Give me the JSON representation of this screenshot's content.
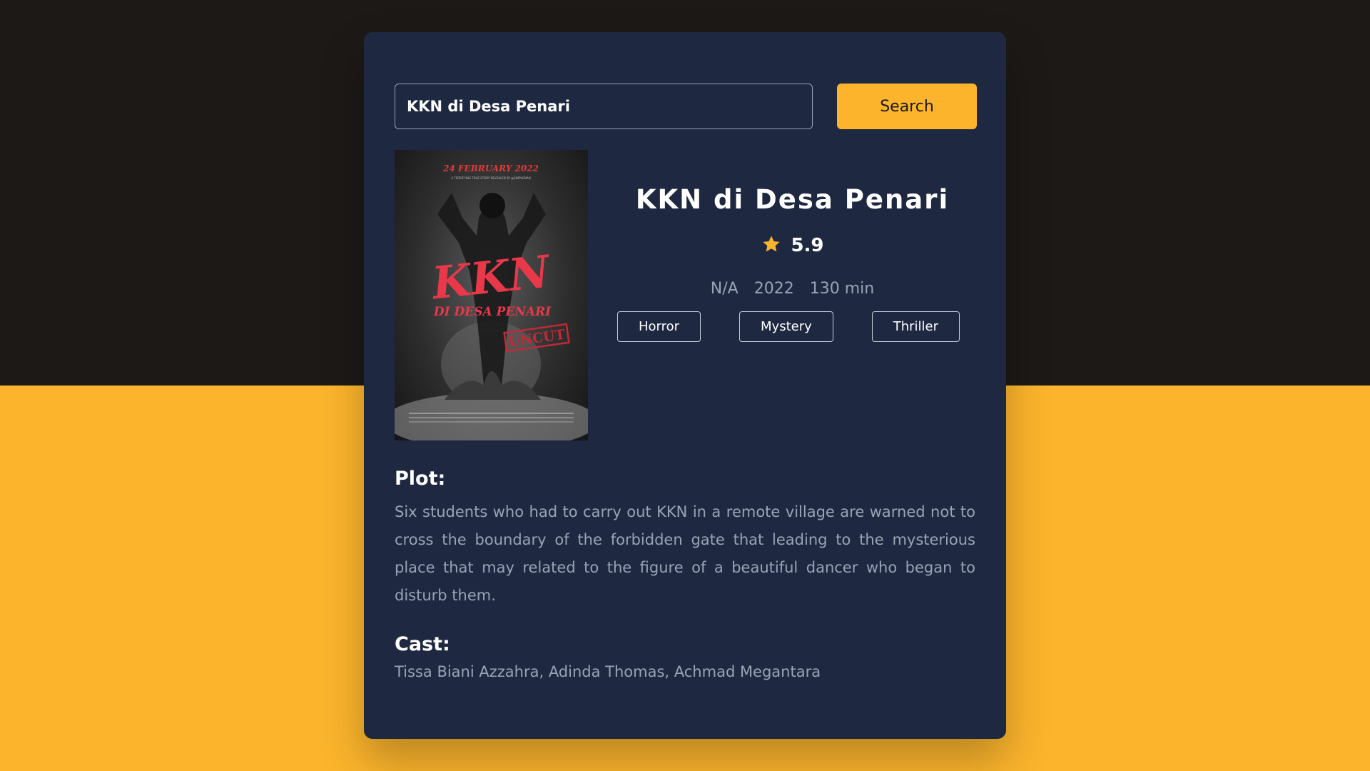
{
  "search": {
    "value": "KKN di Desa Penari",
    "button_label": "Search"
  },
  "poster": {
    "date_text": "24 FEBRUARY 2022",
    "tagline": "A TERRIFYING TRUE STORY REVEALED BY @SIMPLEMAN",
    "logo_top": "KKN",
    "logo_bottom": "DI DESA PENARI",
    "stamp": "UNCUT"
  },
  "movie": {
    "title": "KKN di Desa Penari",
    "rating": "5.9",
    "rated": "N/A",
    "year": "2022",
    "runtime": "130 min",
    "genres": [
      "Horror",
      "Mystery",
      "Thriller"
    ],
    "plot_label": "Plot:",
    "plot": "Six students who had to carry out KKN in a remote village are warned not to cross the boundary of the forbidden gate that leading to the mysterious place that may related to the figure of a beautiful dancer who began to disturb them.",
    "cast_label": "Cast:",
    "cast": "Tissa Biani Azzahra, Adinda Thomas, Achmad Megantara"
  },
  "colors": {
    "accent": "#fbb42c",
    "card": "#1e2840",
    "top_background": "#1c1917",
    "muted_text": "#9aa3b5"
  }
}
